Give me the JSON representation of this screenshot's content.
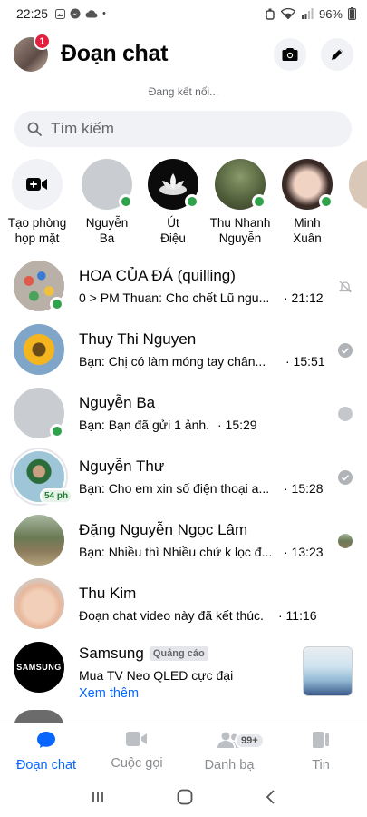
{
  "status_bar": {
    "time": "22:25",
    "battery": "96%"
  },
  "header": {
    "title": "Đoạn chat",
    "notification_count": "1"
  },
  "connection_status": "Đang kết nối...",
  "search": {
    "placeholder": "Tìm kiếm"
  },
  "stories": [
    {
      "name_line1": "Tạo phòng",
      "name_line2": "họp mặt"
    },
    {
      "name_line1": "Nguyễn",
      "name_line2": "Ba"
    },
    {
      "name_line1": "Út",
      "name_line2": "Điệu"
    },
    {
      "name_line1": "Thu Nhanh",
      "name_line2": "Nguyễn"
    },
    {
      "name_line1": "Minh",
      "name_line2": "Xuân"
    }
  ],
  "chats": [
    {
      "name": "HOA CỦA ĐÁ (quilling)",
      "message": "0 > PM Thuan: Cho chết  Lũ ngu...",
      "time": "· 21:12"
    },
    {
      "name": "Thuy Thi Nguyen",
      "message": "Bạn: Chị có làm móng tay chân...",
      "time": "· 15:51"
    },
    {
      "name": "Nguyễn Ba",
      "message": "Bạn: Bạn đã gửi 1 ảnh.",
      "time": "· 15:29"
    },
    {
      "name": "Nguyễn Thư",
      "message": "Bạn: Cho em xin số điện thoại a...",
      "time": "· 15:28",
      "active_ago": "54 ph"
    },
    {
      "name": "Đặng Nguyễn Ngọc Lâm",
      "message": "Bạn: Nhiều thì Nhiều chứ k lọc đ...",
      "time": "· 13:23"
    },
    {
      "name": "Thu Kim",
      "message": "Đoạn chat video này đã kết thúc.",
      "time": "· 11:16"
    }
  ],
  "ad": {
    "name": "Samsung",
    "tag": "Quảng cáo",
    "text": "Mua TV Neo QLED cực đại",
    "link": "Xem thêm",
    "logo_text": "SAMSUNG"
  },
  "bottom_nav": {
    "chats": "Đoạn chat",
    "calls": "Cuộc gọi",
    "people": "Danh bạ",
    "people_badge": "99+",
    "stories": "Tin"
  },
  "colors": {
    "accent": "#0866ff",
    "online": "#31a24c",
    "badge": "#e41e3f"
  }
}
